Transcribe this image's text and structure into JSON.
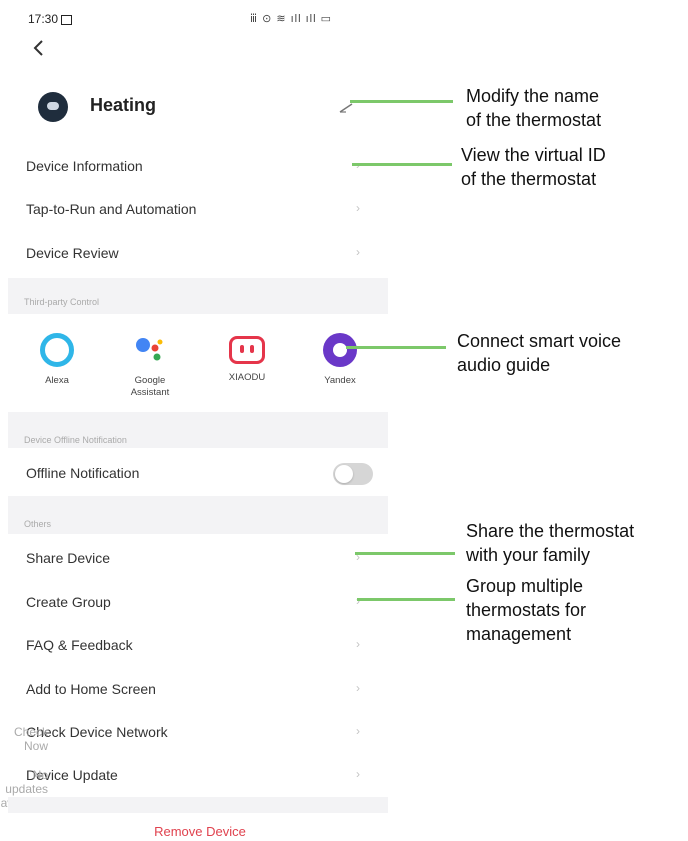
{
  "status_bar": {
    "time": "17:30",
    "icons": "ⅲ ⊙ ≋ ıll ıll ▭"
  },
  "header": {
    "back_icon": "chevron-left-icon",
    "device_name": "Heating",
    "edit_icon": "pencil-icon"
  },
  "menu": {
    "device_information": "Device Information",
    "tap_to_run": "Tap-to-Run and Automation",
    "device_review": "Device Review"
  },
  "third_party": {
    "section_title": "Third-party Control",
    "vendors": [
      {
        "name": "Alexa",
        "icon": "alexa-icon"
      },
      {
        "name": "Google\nAssistant",
        "icon": "google-assistant-icon"
      },
      {
        "name": "XIAODU",
        "icon": "xiaodu-icon"
      },
      {
        "name": "Yandex",
        "icon": "yandex-icon"
      }
    ]
  },
  "offline": {
    "section_title": "Device Offline Notification",
    "label": "Offline Notification",
    "enabled": false
  },
  "others": {
    "section_title": "Others",
    "share_device": "Share Device",
    "create_group": "Create Group",
    "faq": "FAQ & Feedback",
    "add_home": "Add to Home Screen",
    "check_network": "Check Device Network",
    "check_network_value": "Check Now",
    "device_update": "Device Update",
    "device_update_value": "No updates available"
  },
  "remove_device": "Remove Device",
  "annotations": {
    "modify_name": "Modify the name\nof the thermostat",
    "virtual_id": "View the virtual ID\n of the thermostat",
    "voice": "Connect smart voice\n audio guide",
    "share": "Share the thermostat\nwith your family",
    "group": "Group multiple\nthermostats for\nmanagement"
  },
  "colors": {
    "accent_line": "#7cc86a",
    "remove": "#e0424e",
    "section_bg": "#f3f3f5"
  }
}
